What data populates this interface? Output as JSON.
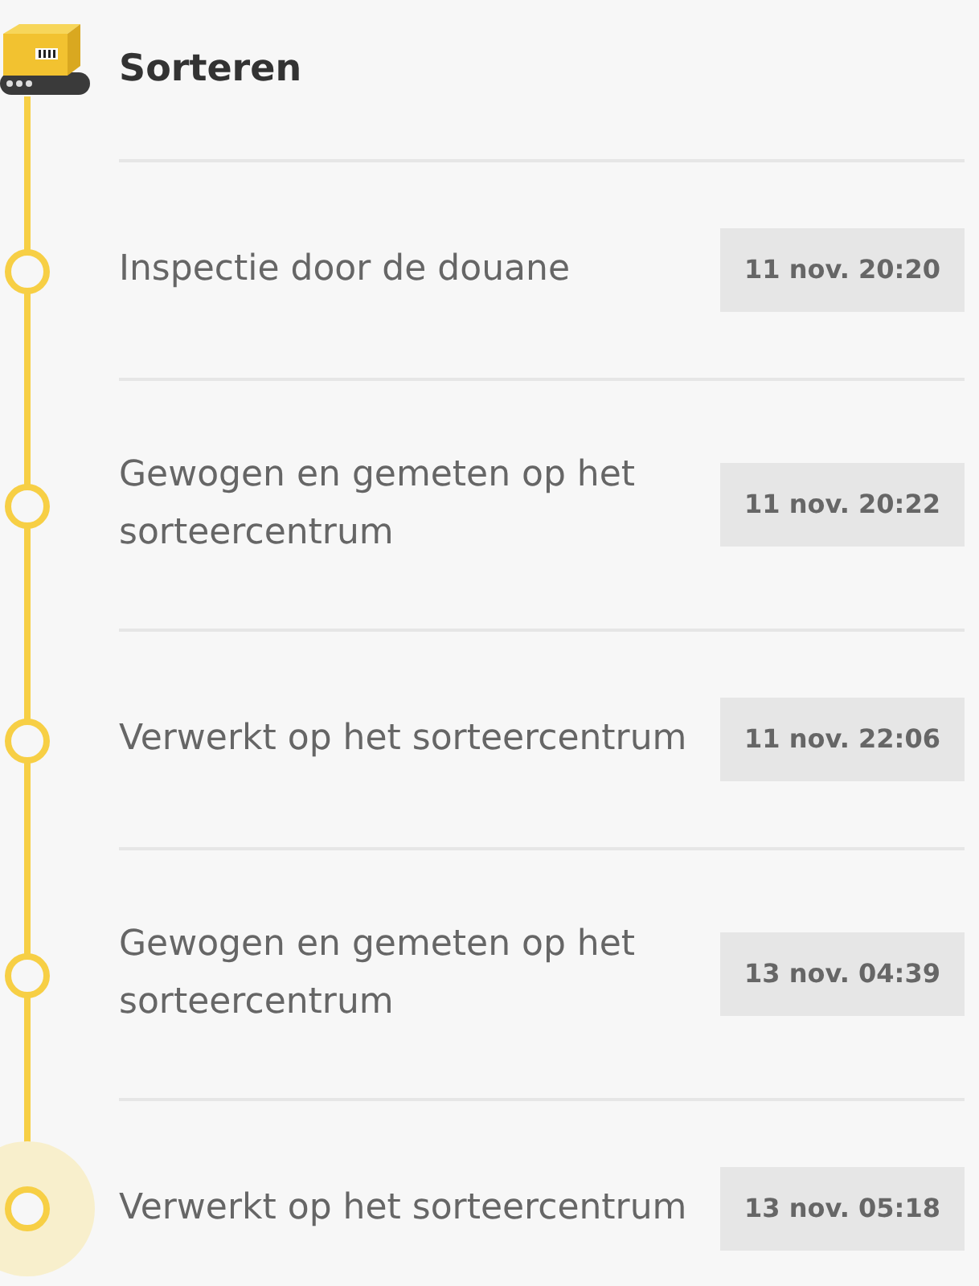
{
  "section": {
    "title": "Sorteren"
  },
  "events": [
    {
      "label": "Inspectie door de douane",
      "time": "11 nov. 20:20",
      "current": false
    },
    {
      "label": "Gewogen en gemeten op het sorteercentrum",
      "time": "11 nov. 20:22",
      "current": false
    },
    {
      "label": "Verwerkt op het sorteercentrum",
      "time": "11 nov. 22:06",
      "current": false
    },
    {
      "label": "Gewogen en gemeten op het sorteercentrum",
      "time": "13 nov. 04:39",
      "current": false
    },
    {
      "label": "Verwerkt op het sorteercentrum",
      "time": "13 nov. 05:18",
      "current": true
    }
  ]
}
